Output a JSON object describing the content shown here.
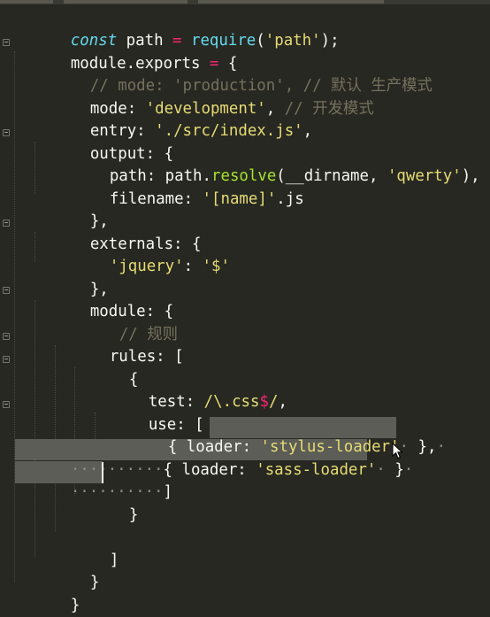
{
  "editor": {
    "theme_colors": {
      "background": "#272822",
      "keyword": "#66d9ef",
      "function": "#a6e22e",
      "string": "#e6db74",
      "operator": "#f92672",
      "comment": "#75715e",
      "text": "#f8f8f2",
      "selection": "#5b5d56"
    },
    "lines": {
      "l1": {
        "const": "const",
        "path": " path ",
        "eq": "=",
        "sp": " ",
        "require": "require",
        "open": "(",
        "arg": "'path'",
        "close": ");"
      },
      "l2": {
        "a": "module.exports ",
        "eq": "=",
        "b": " {"
      },
      "l3": {
        "comment": "// mode: 'production', // 默认 生产模式"
      },
      "l4": {
        "key": "mode: ",
        "val": "'development'",
        "comma": ", ",
        "comment": "// 开发模式"
      },
      "l5": {
        "key": "entry: ",
        "val": "'./src/index.js'",
        "comma": ","
      },
      "l6": {
        "text": "output: {"
      },
      "l7": {
        "key": "path: path.",
        "fn": "resolve",
        "open": "(__dirname, ",
        "val": "'qwerty'",
        "close": "),"
      },
      "l8": {
        "key": "filename: ",
        "val": "'[name]'",
        "rest": ".js"
      },
      "l9": {
        "text": "},"
      },
      "l10": {
        "text": "externals: {"
      },
      "l11": {
        "key": "'jquery'",
        "colon": ": ",
        "val": "'$'"
      },
      "l12": {
        "text": "},"
      },
      "l13": {
        "text": "module: {"
      },
      "l14": {
        "comment": "// 规则"
      },
      "l15": {
        "text": "rules: ["
      },
      "l16": {
        "text": "{"
      },
      "l17": {
        "key": "test: ",
        "re": "/\\.css",
        "dollar": "$",
        "re2": "/",
        "comma": ","
      },
      "l18": {
        "text": "use: ["
      },
      "l19": {
        "open": "{ loader: ",
        "val": "'stylus-loader'",
        "close": " },",
        "ws1": "·",
        "ws2": "·"
      },
      "l20": {
        "dots": "··········",
        "open": "{ loader: ",
        "val": "'sass-loader'",
        "close": " }",
        "ws1": "·",
        "ws2": "·"
      },
      "l21": {
        "dots": "··········",
        "text": "]"
      },
      "l22": {
        "text": "}"
      },
      "l24": {
        "text": "]"
      },
      "l25": {
        "text": "}"
      },
      "l26": {
        "text": "}"
      }
    }
  }
}
